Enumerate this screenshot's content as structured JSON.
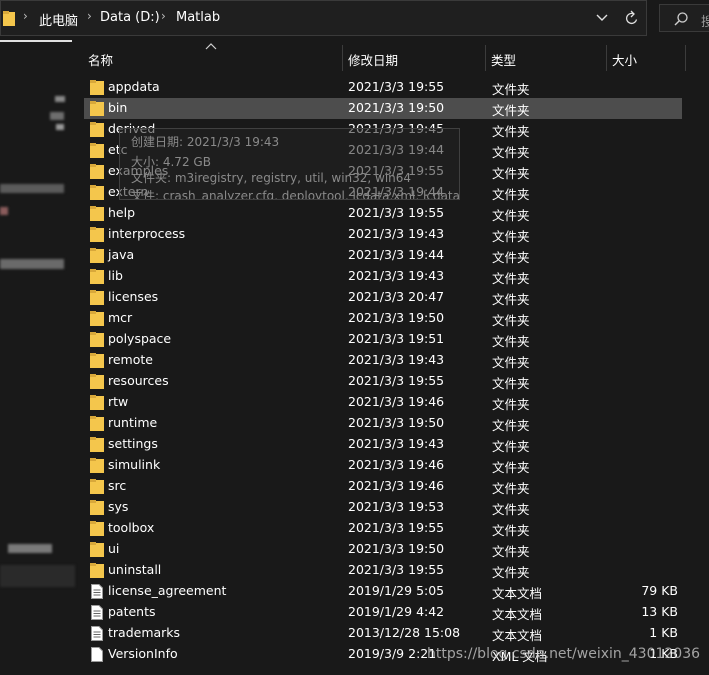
{
  "address": {
    "crumbs": [
      "此电脑",
      "Data (D:)",
      "Matlab"
    ],
    "search_placeholder": "搜"
  },
  "columns": {
    "name": "名称",
    "modified": "修改日期",
    "type": "类型",
    "size": "大小"
  },
  "rows": [
    {
      "name": "appdata",
      "date": "2021/3/3 19:55",
      "type": "文件夹",
      "size": "",
      "icon": "folder"
    },
    {
      "name": "bin",
      "date": "2021/3/3 19:50",
      "type": "文件夹",
      "size": "",
      "icon": "folder",
      "selected": true
    },
    {
      "name": "derived",
      "date": "2021/3/3 19:45",
      "type": "文件夹",
      "size": "",
      "icon": "folder"
    },
    {
      "name": "etc",
      "date": "2021/3/3 19:44",
      "type": "文件夹",
      "size": "",
      "icon": "folder"
    },
    {
      "name": "examples",
      "date": "2021/3/3 19:55",
      "type": "文件夹",
      "size": "",
      "icon": "folder"
    },
    {
      "name": "extern",
      "date": "2021/3/3 19:44",
      "type": "文件夹",
      "size": "",
      "icon": "folder"
    },
    {
      "name": "help",
      "date": "2021/3/3 19:55",
      "type": "文件夹",
      "size": "",
      "icon": "folder"
    },
    {
      "name": "interprocess",
      "date": "2021/3/3 19:43",
      "type": "文件夹",
      "size": "",
      "icon": "folder"
    },
    {
      "name": "java",
      "date": "2021/3/3 19:44",
      "type": "文件夹",
      "size": "",
      "icon": "folder"
    },
    {
      "name": "lib",
      "date": "2021/3/3 19:43",
      "type": "文件夹",
      "size": "",
      "icon": "folder"
    },
    {
      "name": "licenses",
      "date": "2021/3/3 20:47",
      "type": "文件夹",
      "size": "",
      "icon": "folder"
    },
    {
      "name": "mcr",
      "date": "2021/3/3 19:50",
      "type": "文件夹",
      "size": "",
      "icon": "folder"
    },
    {
      "name": "polyspace",
      "date": "2021/3/3 19:51",
      "type": "文件夹",
      "size": "",
      "icon": "folder"
    },
    {
      "name": "remote",
      "date": "2021/3/3 19:43",
      "type": "文件夹",
      "size": "",
      "icon": "folder"
    },
    {
      "name": "resources",
      "date": "2021/3/3 19:55",
      "type": "文件夹",
      "size": "",
      "icon": "folder"
    },
    {
      "name": "rtw",
      "date": "2021/3/3 19:46",
      "type": "文件夹",
      "size": "",
      "icon": "folder"
    },
    {
      "name": "runtime",
      "date": "2021/3/3 19:50",
      "type": "文件夹",
      "size": "",
      "icon": "folder"
    },
    {
      "name": "settings",
      "date": "2021/3/3 19:43",
      "type": "文件夹",
      "size": "",
      "icon": "folder"
    },
    {
      "name": "simulink",
      "date": "2021/3/3 19:46",
      "type": "文件夹",
      "size": "",
      "icon": "folder"
    },
    {
      "name": "src",
      "date": "2021/3/3 19:46",
      "type": "文件夹",
      "size": "",
      "icon": "folder"
    },
    {
      "name": "sys",
      "date": "2021/3/3 19:53",
      "type": "文件夹",
      "size": "",
      "icon": "folder"
    },
    {
      "name": "toolbox",
      "date": "2021/3/3 19:55",
      "type": "文件夹",
      "size": "",
      "icon": "folder"
    },
    {
      "name": "ui",
      "date": "2021/3/3 19:50",
      "type": "文件夹",
      "size": "",
      "icon": "folder"
    },
    {
      "name": "uninstall",
      "date": "2021/3/3 19:55",
      "type": "文件夹",
      "size": "",
      "icon": "folder"
    },
    {
      "name": "license_agreement",
      "date": "2019/1/29 5:05",
      "type": "文本文档",
      "size": "79 KB",
      "icon": "text-file"
    },
    {
      "name": "patents",
      "date": "2019/1/29 4:42",
      "type": "文本文档",
      "size": "13 KB",
      "icon": "text-file"
    },
    {
      "name": "trademarks",
      "date": "2013/12/28 15:08",
      "type": "文本文档",
      "size": "1 KB",
      "icon": "text-file"
    },
    {
      "name": "VersionInfo",
      "date": "2019/3/9 2:21",
      "type": "XML 文档",
      "size": "1 KB",
      "icon": "blank-file"
    }
  ],
  "tooltip": {
    "created": "创建日期: 2021/3/3 19:43",
    "size": "大小: 4.72 GB",
    "folders": "文件夹: m3iregistry, registry, util, win32, win64",
    "files": "文件: crash_analyzer.cfg, deploytool, lcdata.xml, lcdata_utf8.xml, ..."
  },
  "watermark": "https://blog.csdn.net/weixin_43012036",
  "colors": {
    "background": "#191919",
    "selected_row": "#4d4d4d",
    "folder": "#f4c64c"
  }
}
